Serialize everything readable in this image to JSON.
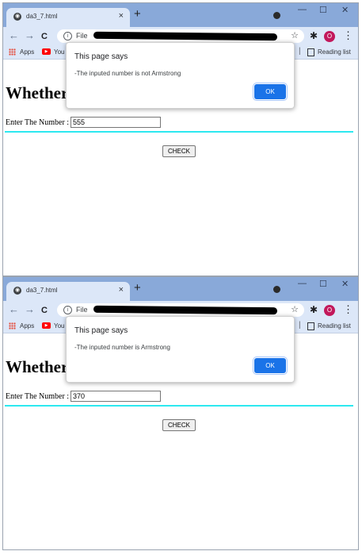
{
  "colors": {
    "titlebar": "#89a9d9",
    "toolbar": "#dce7f8",
    "accent_line": "#2de8f0",
    "ok_button": "#1a73e8",
    "avatar": "#c2185b"
  },
  "browser": {
    "tab_title": "da3_7.html",
    "tab_close": "×",
    "new_tab": "+",
    "minimize": "—",
    "maximize": "☐",
    "close": "✕",
    "back": "←",
    "forward": "→",
    "reload": "C",
    "info_icon": "i",
    "address_scheme": "File",
    "bookmark_star": "☆",
    "extensions_icon": "✱",
    "profile_initial": "O",
    "menu": "⋮",
    "bookmarks": {
      "apps": "Apps",
      "youtube": "You",
      "reading_list": "Reading list"
    }
  },
  "page": {
    "heading": "Whether",
    "label": "Enter The Number :",
    "check_button": "CHECK"
  },
  "shots": [
    {
      "input_value": "555",
      "dialog": {
        "title": "This page says",
        "message": "-The inputed number is not Armstrong",
        "ok": "OK"
      }
    },
    {
      "input_value": "370",
      "dialog": {
        "title": "This page says",
        "message": "-The inputed number is Armstrong",
        "ok": "OK"
      }
    }
  ]
}
